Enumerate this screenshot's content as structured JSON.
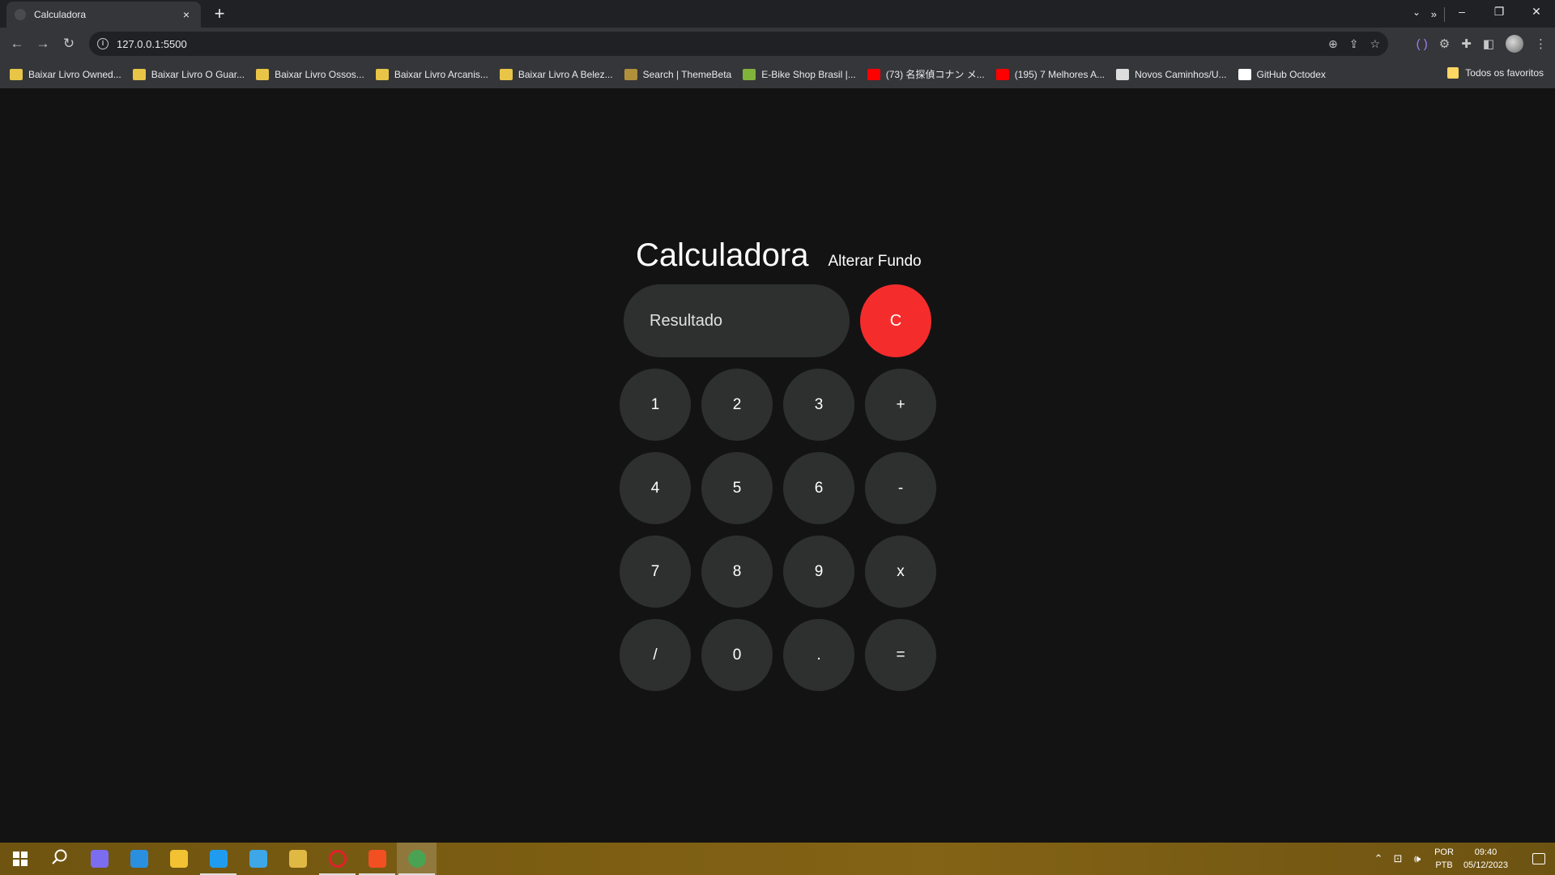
{
  "browser": {
    "tab_title": "Calculadora",
    "tab_close": "×",
    "new_tab": "+",
    "url": "127.0.0.1:5500",
    "bookmarks": [
      {
        "label": "Baixar Livro Owned...",
        "icon_color": "#e8c547"
      },
      {
        "label": "Baixar Livro O Guar...",
        "icon_color": "#e8c547"
      },
      {
        "label": "Baixar Livro Ossos...",
        "icon_color": "#e8c547"
      },
      {
        "label": "Baixar Livro Arcanis...",
        "icon_color": "#e8c547"
      },
      {
        "label": "Baixar Livro A Belez...",
        "icon_color": "#e8c547"
      },
      {
        "label": "Search | ThemeBeta",
        "icon_color": "#b0903a"
      },
      {
        "label": "E-Bike Shop Brasil |...",
        "icon_color": "#7fb33a"
      },
      {
        "label": "(73) 名探偵コナン メ...",
        "icon_color": "#ff0000"
      },
      {
        "label": "(195) 7 Melhores A...",
        "icon_color": "#ff0000"
      },
      {
        "label": "Novos Caminhos/U...",
        "icon_color": "#dddddd"
      },
      {
        "label": "GitHub Octodex",
        "icon_color": "#ffffff"
      }
    ],
    "bookmarks_more": "»",
    "all_bookmarks": "Todos os favoritos"
  },
  "page": {
    "title": "Calculadora",
    "toggle_bg_label": "Alterar Fundo",
    "display_placeholder": "Resultado",
    "clear_label": "C",
    "keys": [
      "1",
      "2",
      "3",
      "+",
      "4",
      "5",
      "6",
      "-",
      "7",
      "8",
      "9",
      "x",
      "/",
      "0",
      ".",
      "="
    ],
    "accent_color": "#f52c2c"
  },
  "taskbar": {
    "apps": [
      {
        "name": "search-icon",
        "color": ""
      },
      {
        "name": "copilot-icon",
        "color": "#7b6cf0"
      },
      {
        "name": "store-icon",
        "color": "#2b8fe0"
      },
      {
        "name": "file-explorer-icon",
        "color": "#f2c233"
      },
      {
        "name": "vscode-icon",
        "color": "#1f9cf0"
      },
      {
        "name": "app-icon",
        "color": "#3da7e8"
      },
      {
        "name": "app-icon",
        "color": "#e0b844"
      },
      {
        "name": "opera-icon",
        "color": "#e3202a"
      },
      {
        "name": "brave-icon",
        "color": "#f24f22"
      },
      {
        "name": "chrome-icon",
        "color": "#4aa353"
      }
    ],
    "lang_top": "POR",
    "lang_bottom": "PTB",
    "time": "09:40",
    "date": "05/12/2023"
  }
}
